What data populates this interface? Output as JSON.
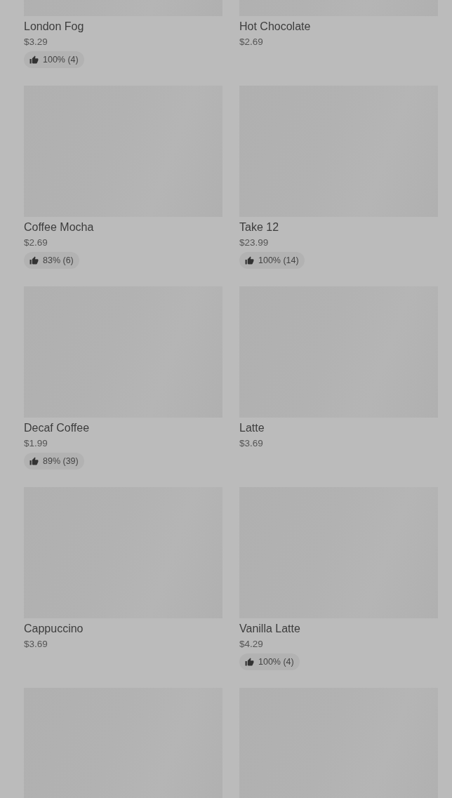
{
  "items": [
    {
      "kind": "product",
      "name": "London Fog",
      "price": "$3.29",
      "rating": "100% (4)"
    },
    {
      "kind": "product",
      "name": "Hot Chocolate",
      "price": "$2.69"
    },
    {
      "kind": "product",
      "name": "Coffee Mocha",
      "price": "$2.69",
      "rating": "83% (6)"
    },
    {
      "kind": "product",
      "name": "Take 12",
      "price": "$23.99",
      "rating": "100% (14)"
    },
    {
      "kind": "product",
      "name": "Decaf Coffee",
      "price": "$1.99",
      "rating": "89% (39)"
    },
    {
      "kind": "product",
      "name": "Latte",
      "price": "$3.69"
    },
    {
      "kind": "product",
      "name": "Cappuccino",
      "price": "$3.69"
    },
    {
      "kind": "product",
      "name": "Vanilla Latte",
      "price": "$4.29",
      "rating": "100% (4)"
    },
    {
      "kind": "image-only"
    },
    {
      "kind": "image-only"
    }
  ]
}
